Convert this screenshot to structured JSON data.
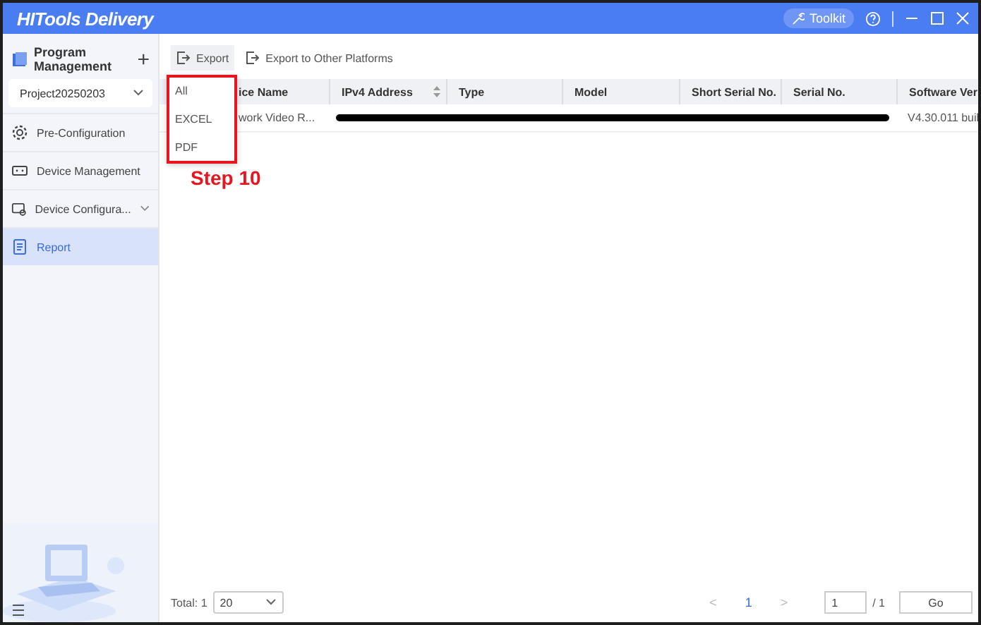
{
  "window": {
    "title": "HITools Delivery",
    "toolkit": "Toolkit"
  },
  "sidebar": {
    "header": "Program Management",
    "add": "+",
    "project": "Project20250203",
    "items": [
      {
        "label": "Pre-Configuration",
        "kind": "gear",
        "selected": false
      },
      {
        "label": "Device Management",
        "kind": "device",
        "selected": false
      },
      {
        "label": "Device Configura...",
        "kind": "config",
        "selected": false,
        "expanded": false
      },
      {
        "label": "Report",
        "kind": "report",
        "selected": true
      }
    ]
  },
  "toolbar": {
    "buttons": [
      "Export",
      "Export to Other Platforms"
    ]
  },
  "export_menu": {
    "items": [
      "All",
      "EXCEL",
      "PDF"
    ]
  },
  "annotation": "Step 10",
  "table": {
    "columns": [
      {
        "label": "ice Name",
        "sortable": false
      },
      {
        "label": "IPv4 Address",
        "sortable": true
      },
      {
        "label": "Type",
        "sortable": false
      },
      {
        "label": "Model",
        "sortable": false
      },
      {
        "label": "Short Serial No.",
        "sortable": false
      },
      {
        "label": "Serial No.",
        "sortable": false
      },
      {
        "label": "Software Ver",
        "sortable": false
      }
    ],
    "rows": [
      {
        "cells": [
          "work Video R...",
          "",
          "",
          "",
          "",
          "",
          "V4.30.011 buil"
        ],
        "redacted": true
      }
    ]
  },
  "footer": {
    "total": "Total: 1",
    "page_size": "20",
    "prev": "<",
    "page": "1",
    "next": ">",
    "page_input": "1",
    "pages": "/ 1",
    "go": "Go"
  }
}
